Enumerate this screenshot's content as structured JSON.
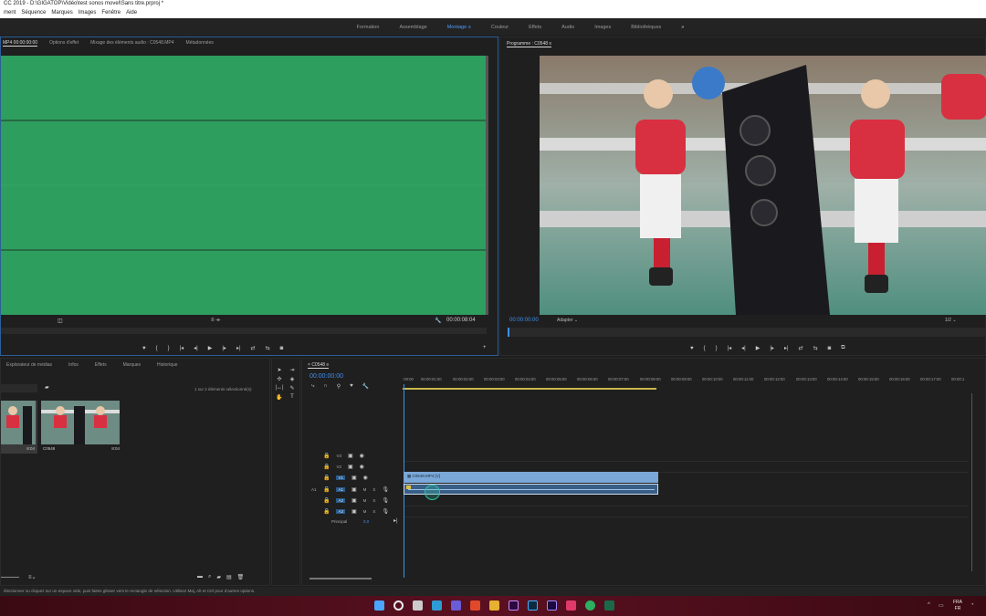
{
  "title_bar": "CC 2019 - D:\\GIGATOP\\Vidéo\\test sonos movel\\Sans titre.prproj *",
  "menu": [
    "ment",
    "Séquence",
    "Marques",
    "Images",
    "Fenêtre",
    "Aide"
  ],
  "workspaces": {
    "items": [
      "Formation",
      "Assemblage",
      "Montage",
      "Couleur",
      "Effets",
      "Audio",
      "Images",
      "Bibliothèques"
    ],
    "active": "Montage",
    "more": "»"
  },
  "source_panel": {
    "tabs": [
      "MP4 00:00:00:00",
      "Options d'effet",
      "Mixage des éléments audio : C0548.MP4",
      "Métadonnées"
    ],
    "timecode_end": "00:00:08:04",
    "waveform_color": "#2e9e5e"
  },
  "program_panel": {
    "title": "Programme : C0548",
    "timecode": "00:00:00:00",
    "fit": "Adapter",
    "resolution": "1/2"
  },
  "project_panel": {
    "tabs": [
      "Explorateur de médias",
      "Infos",
      "Effets",
      "Marques",
      "Historique"
    ],
    "selection_info": "1 sur 2 éléments sélectionné(s)",
    "clips": [
      {
        "name": "",
        "duration": "8:04"
      },
      {
        "name": "C0548",
        "duration": "8:04"
      }
    ]
  },
  "timeline": {
    "sequence_name": "C0548",
    "timecode": "00:00:00:00",
    "ruler": [
      ":00:00",
      "00:00:01:00",
      "00:00:02:00",
      "00:00:03:00",
      "00:00:04:00",
      "00:00:05:00",
      "00:00:06:00",
      "00:00:07:00",
      "00:00:08:00",
      "00:00:09:00",
      "00:00:10:00",
      "00:00:11:00",
      "00:00:12:00",
      "00:00:13:00",
      "00:00:14:00",
      "00:00:15:00",
      "00:00:16:00",
      "00:00:17:00",
      "00:00:1"
    ],
    "video_tracks": [
      "V3",
      "V2",
      "V1"
    ],
    "audio_tracks": [
      "A1",
      "A2",
      "A3"
    ],
    "audio_source_label": "A1",
    "master_label": "Principal",
    "master_value": "0,0",
    "clip_label": "C0548.MP4 [V]"
  },
  "status_bar": "électionner ou cliquez sur un espace vide, puis faites glisser vers le rectangle de sélection. Utilisez Maj, Alt et Ctrl pour d'autres options.",
  "taskbar": {
    "lang": "FRA",
    "region": "FR",
    "icons": [
      "windows-icon",
      "search-icon",
      "taskview-icon",
      "teams-icon",
      "files-icon",
      "brave-icon",
      "explorer-icon",
      "premiere-icon",
      "photoshop-icon",
      "aftereffects-icon",
      "mail-icon",
      "whatsapp-icon",
      "app-icon"
    ]
  },
  "colors": {
    "accent": "#3d8ff0",
    "clip_video": "#7aa8d8",
    "clip_audio": "#3a5f86"
  }
}
